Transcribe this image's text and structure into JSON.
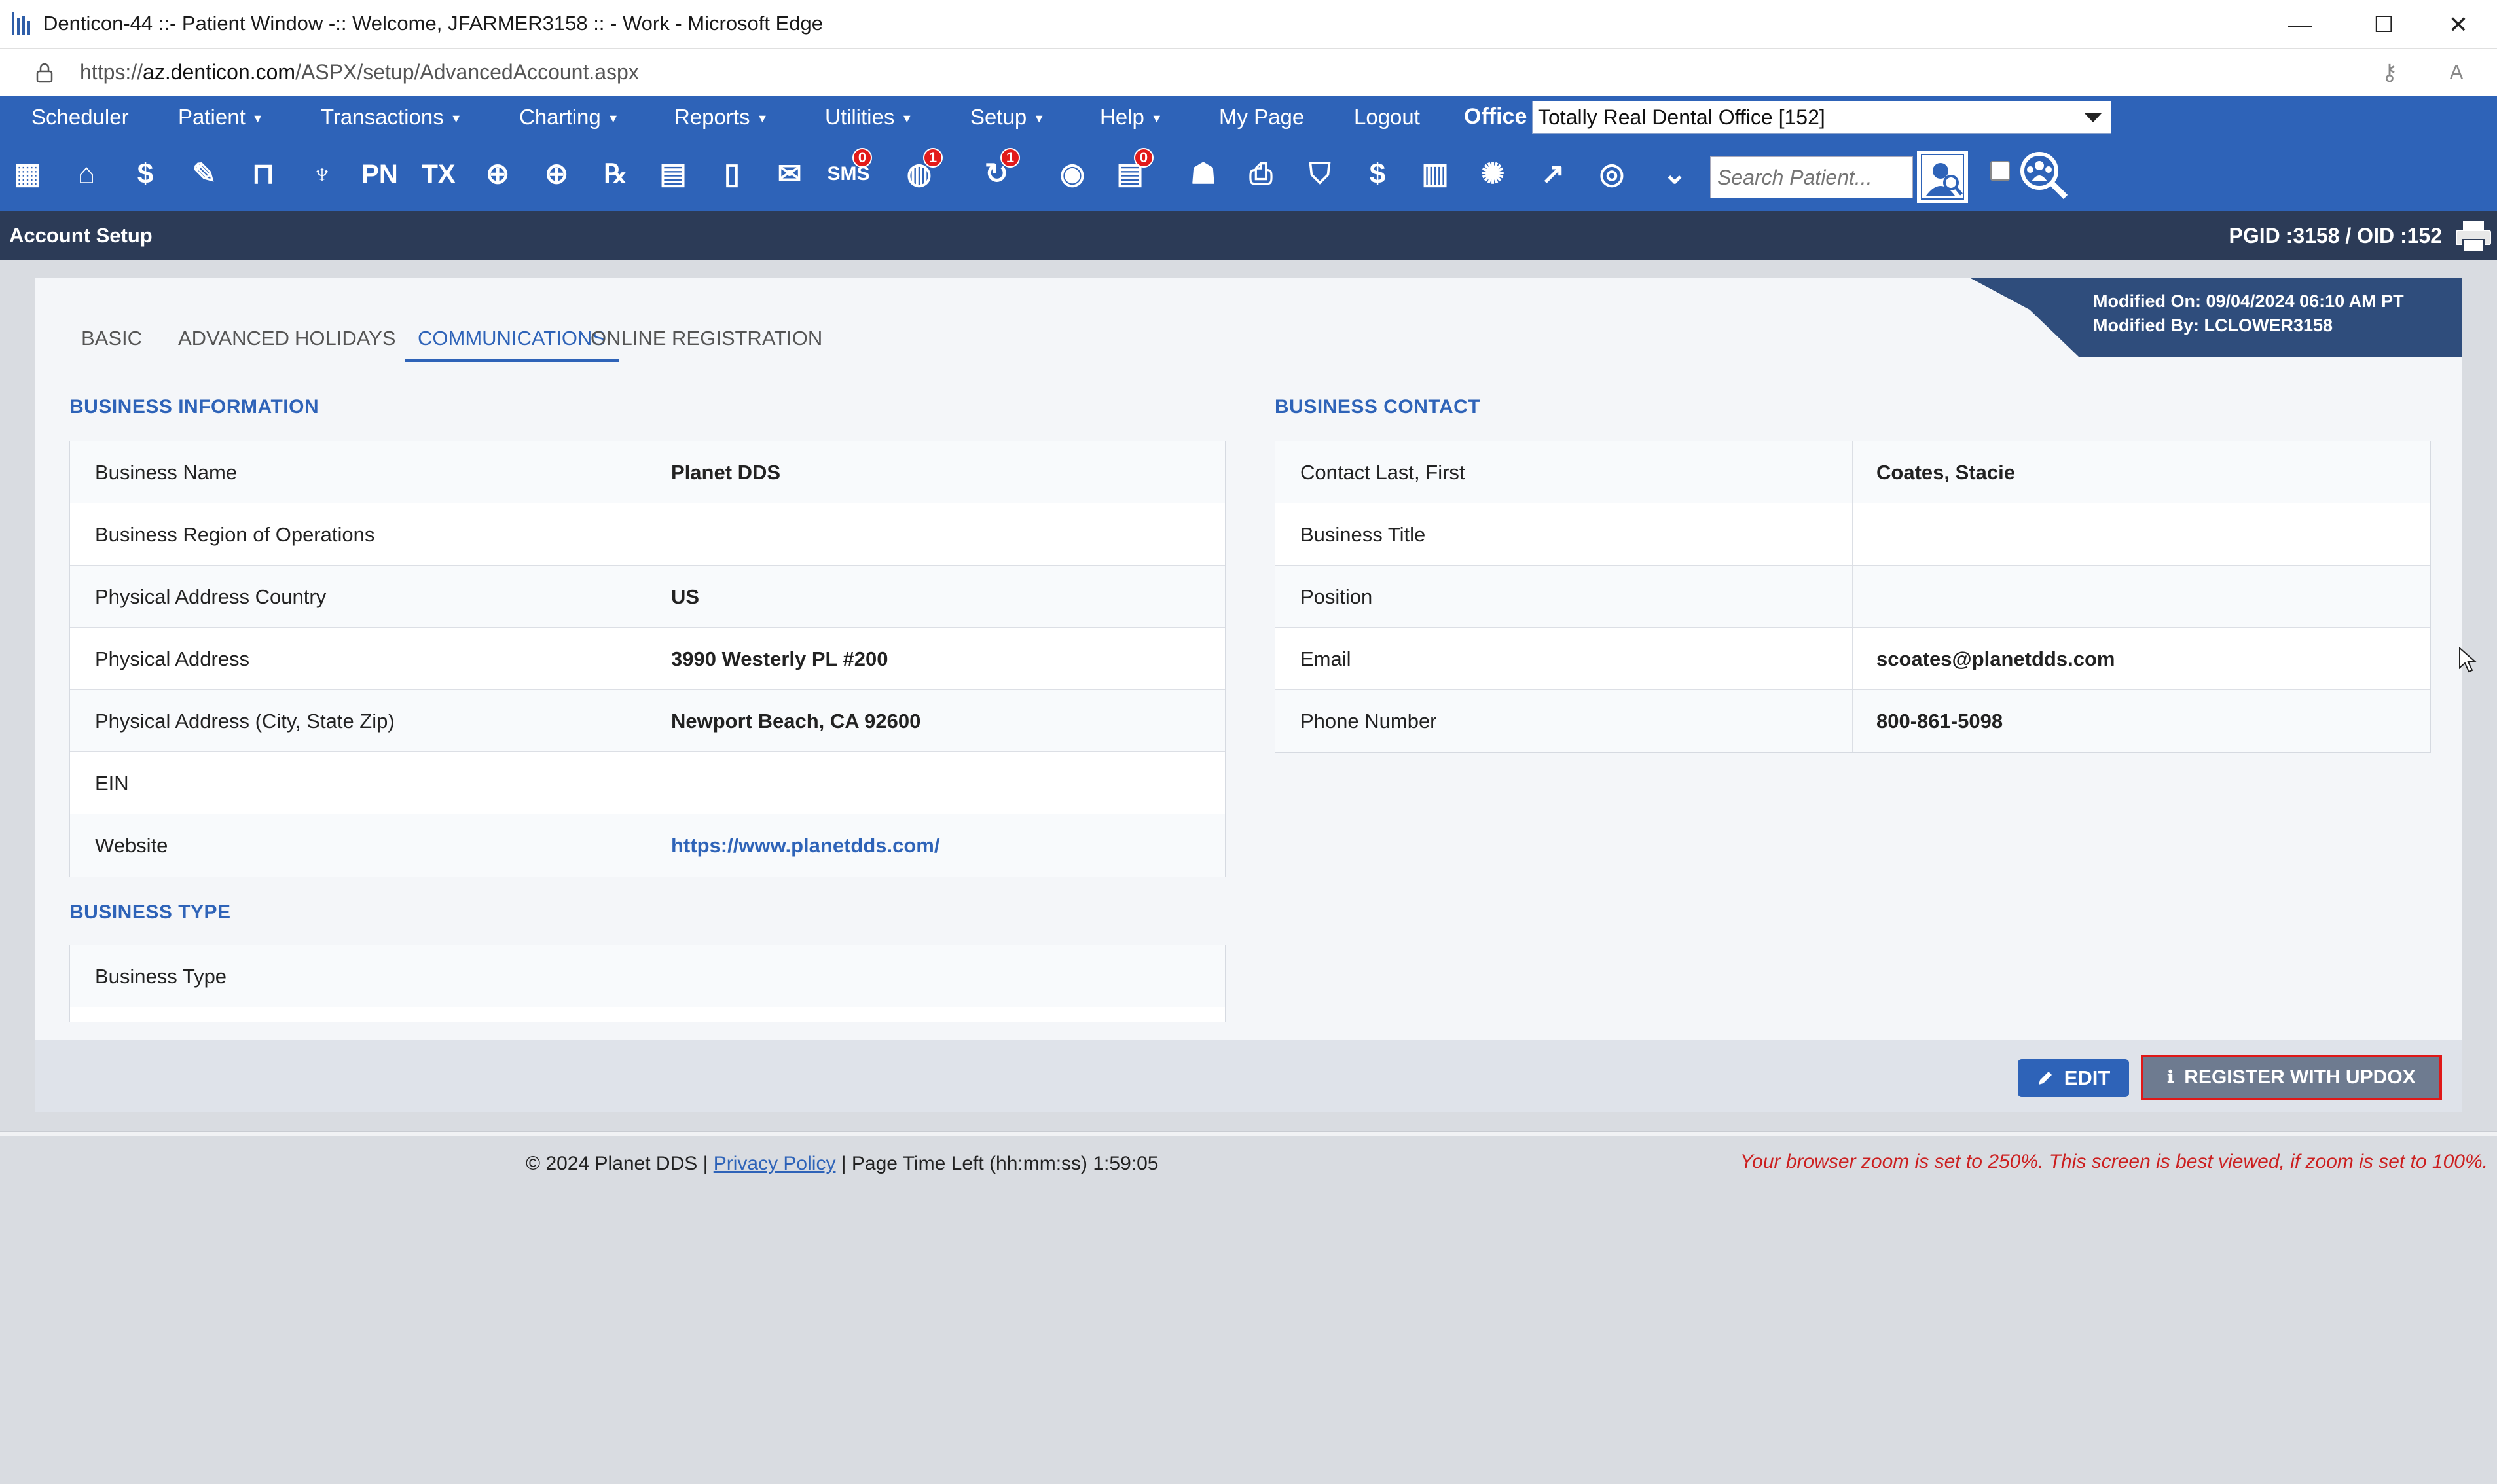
{
  "window": {
    "title": "Denticon-44 ::- Patient Window -:: Welcome, JFARMER3158 :: - Work - Microsoft Edge",
    "minimize": "—",
    "maximize": "☐",
    "close": "✕"
  },
  "address": {
    "url_prefix": "https://",
    "url_host": "az.denticon.com",
    "url_path": "/ASPX/setup/AdvancedAccount.aspx"
  },
  "menu": {
    "items": [
      {
        "label": "Scheduler",
        "caret": false
      },
      {
        "label": "Patient",
        "caret": true
      },
      {
        "label": "Transactions",
        "caret": true
      },
      {
        "label": "Charting",
        "caret": true
      },
      {
        "label": "Reports",
        "caret": true
      },
      {
        "label": "Utilities",
        "caret": true
      },
      {
        "label": "Setup",
        "caret": true
      },
      {
        "label": "Help",
        "caret": true
      },
      {
        "label": "My Page",
        "caret": false
      },
      {
        "label": "Logout",
        "caret": false
      }
    ],
    "office_label": "Office",
    "office_value": "Totally Real Dental Office [152]"
  },
  "toolbar": {
    "icons": [
      {
        "name": "calendar-icon"
      },
      {
        "name": "home-icon"
      },
      {
        "name": "dollar-icon"
      },
      {
        "name": "notes-edit-icon"
      },
      {
        "name": "tooth-chart-icon"
      },
      {
        "name": "tooth-icon"
      },
      {
        "name": "progress-notes-icon",
        "text": "PN"
      },
      {
        "name": "treatment-icon",
        "text": "TX"
      },
      {
        "name": "add-patient-icon"
      },
      {
        "name": "add-family-icon"
      },
      {
        "name": "prescription-icon",
        "text": "℞"
      },
      {
        "name": "message-icon"
      },
      {
        "name": "document-icon"
      },
      {
        "name": "mail-icon"
      },
      {
        "name": "sms-icon",
        "text": "SMS",
        "badge": "0"
      },
      {
        "name": "web-icon",
        "badge": "1"
      },
      {
        "name": "recall-icon",
        "badge": "1"
      },
      {
        "name": "web-forms-icon"
      },
      {
        "name": "forms-icon",
        "badge": "0"
      },
      {
        "name": "family-icon"
      },
      {
        "name": "print-icon"
      },
      {
        "name": "insurance-icon"
      },
      {
        "name": "claims-icon"
      },
      {
        "name": "ledger-icon"
      },
      {
        "name": "network-icon"
      },
      {
        "name": "chart-line-icon"
      },
      {
        "name": "portal-icon"
      },
      {
        "name": "collapse-icon"
      }
    ],
    "search_placeholder": "Search Patient..."
  },
  "section": {
    "title": "Account Setup",
    "ids": "PGID :3158  /  OID :152"
  },
  "modified": {
    "on": "Modified On: 09/04/2024 06:10 AM PT",
    "by": "Modified By: LCLOWER3158"
  },
  "tabs": [
    "BASIC",
    "ADVANCED",
    "HOLIDAYS",
    "COMMUNICATIONS",
    "ONLINE REGISTRATION"
  ],
  "active_tab": "COMMUNICATIONS",
  "business_info": {
    "heading": "BUSINESS INFORMATION",
    "rows": [
      {
        "label": "Business Name",
        "value": "Planet DDS"
      },
      {
        "label": "Business Region of Operations",
        "value": ""
      },
      {
        "label": "Physical Address Country",
        "value": "US"
      },
      {
        "label": "Physical Address",
        "value": "3990 Westerly PL #200"
      },
      {
        "label": "Physical Address (City, State Zip)",
        "value": "Newport Beach, CA 92600"
      },
      {
        "label": "EIN",
        "value": ""
      },
      {
        "label": "Website",
        "value": "https://www.planetdds.com/",
        "link": true
      }
    ]
  },
  "business_contact": {
    "heading": "BUSINESS CONTACT",
    "rows": [
      {
        "label": "Contact Last, First",
        "value": "Coates, Stacie"
      },
      {
        "label": "Business Title",
        "value": ""
      },
      {
        "label": "Position",
        "value": ""
      },
      {
        "label": "Email",
        "value": "scoates@planetdds.com"
      },
      {
        "label": "Phone Number",
        "value": "800-861-5098"
      }
    ]
  },
  "business_type": {
    "heading": "BUSINESS TYPE",
    "rows": [
      {
        "label": "Business Type",
        "value": ""
      }
    ]
  },
  "buttons": {
    "edit": "EDIT",
    "register": "REGISTER WITH UPDOX"
  },
  "footer": {
    "copyright": "© 2024 Planet DDS |",
    "privacy": "Privacy Policy",
    "time_left": "|  Page Time Left (hh:mm:ss) 1:59:05",
    "zoom_warning": "Your browser zoom is set to 250%. This screen is best viewed, if zoom is set to 100%."
  }
}
